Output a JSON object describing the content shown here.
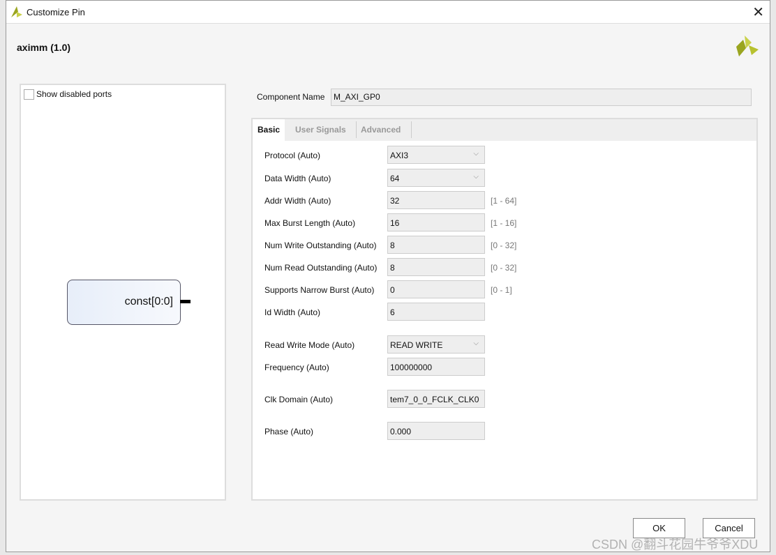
{
  "window": {
    "title": "Customize Pin",
    "close_icon": "close-icon"
  },
  "header": {
    "title": "aximm (1.0)"
  },
  "left_panel": {
    "show_disabled_label": "Show disabled ports",
    "show_disabled_checked": false,
    "block_port": "const[0:0]"
  },
  "component_name": {
    "label": "Component Name",
    "value": "M_AXI_GP0"
  },
  "tabs": [
    {
      "label": "Basic",
      "active": true
    },
    {
      "label": "User Signals"
    },
    {
      "label": "Advanced"
    }
  ],
  "fields": [
    {
      "label": "Protocol (Auto)",
      "value": "AXI3",
      "type": "select",
      "range": ""
    },
    {
      "label": "Data Width (Auto)",
      "value": "64",
      "type": "select",
      "range": ""
    },
    {
      "label": "Addr Width (Auto)",
      "value": "32",
      "type": "text",
      "range": "[1 - 64]"
    },
    {
      "label": "Max Burst Length (Auto)",
      "value": "16",
      "type": "text",
      "range": "[1 - 16]"
    },
    {
      "label": "Num Write Outstanding (Auto)",
      "value": "8",
      "type": "text",
      "range": "[0 - 32]"
    },
    {
      "label": "Num Read Outstanding (Auto)",
      "value": "8",
      "type": "text",
      "range": "[0 - 32]"
    },
    {
      "label": "Supports Narrow Burst (Auto)",
      "value": "0",
      "type": "text",
      "range": "[0 - 1]"
    },
    {
      "label": "Id Width (Auto)",
      "value": "6",
      "type": "text",
      "range": ""
    },
    {
      "label": "Read Write Mode (Auto)",
      "value": "READ WRITE",
      "type": "select",
      "range": ""
    },
    {
      "label": "Frequency (Auto)",
      "value": "100000000",
      "type": "text",
      "range": ""
    },
    {
      "label": "Clk Domain (Auto)",
      "value": "tem7_0_0_FCLK_CLK0",
      "type": "text",
      "range": ""
    },
    {
      "label": "Phase (Auto)",
      "value": "0.000",
      "type": "text",
      "range": ""
    }
  ],
  "buttons": {
    "ok": "OK",
    "cancel": "Cancel"
  },
  "watermark": "CSDN @翻斗花园牛爷爷XDU"
}
